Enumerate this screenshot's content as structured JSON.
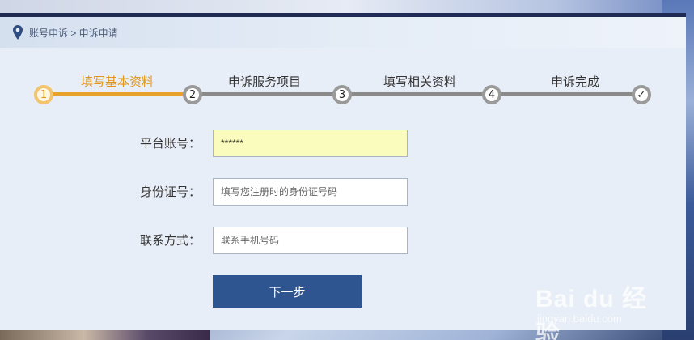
{
  "breadcrumb": {
    "text": "账号申诉 > 申诉申请",
    "icon": "map-pin-icon"
  },
  "steps": [
    {
      "number": "1",
      "label": "填写基本资料",
      "state": "active"
    },
    {
      "number": "2",
      "label": "申诉服务项目",
      "state": "pending"
    },
    {
      "number": "3",
      "label": "填写相关资料",
      "state": "pending"
    },
    {
      "number": "4",
      "label": "申诉完成",
      "state": "pending"
    },
    {
      "number": "✓",
      "label": "",
      "state": "pending"
    }
  ],
  "form": {
    "account": {
      "label": "平台账号：",
      "value": "******",
      "placeholder": ""
    },
    "id_number": {
      "label": "身份证号：",
      "value": "",
      "placeholder": "填写您注册时的身份证号码"
    },
    "contact": {
      "label": "联系方式：",
      "value": "",
      "placeholder": "联系手机号码"
    }
  },
  "buttons": {
    "next_label": "下一步"
  },
  "watermark": {
    "brand": "Bai du 经验",
    "url": "jingyan.baidu.com"
  },
  "colors": {
    "accent": "#e8a12a",
    "button": "#2f5590",
    "header_bar": "#1f2b52",
    "filled_input": "#fafcbe"
  }
}
